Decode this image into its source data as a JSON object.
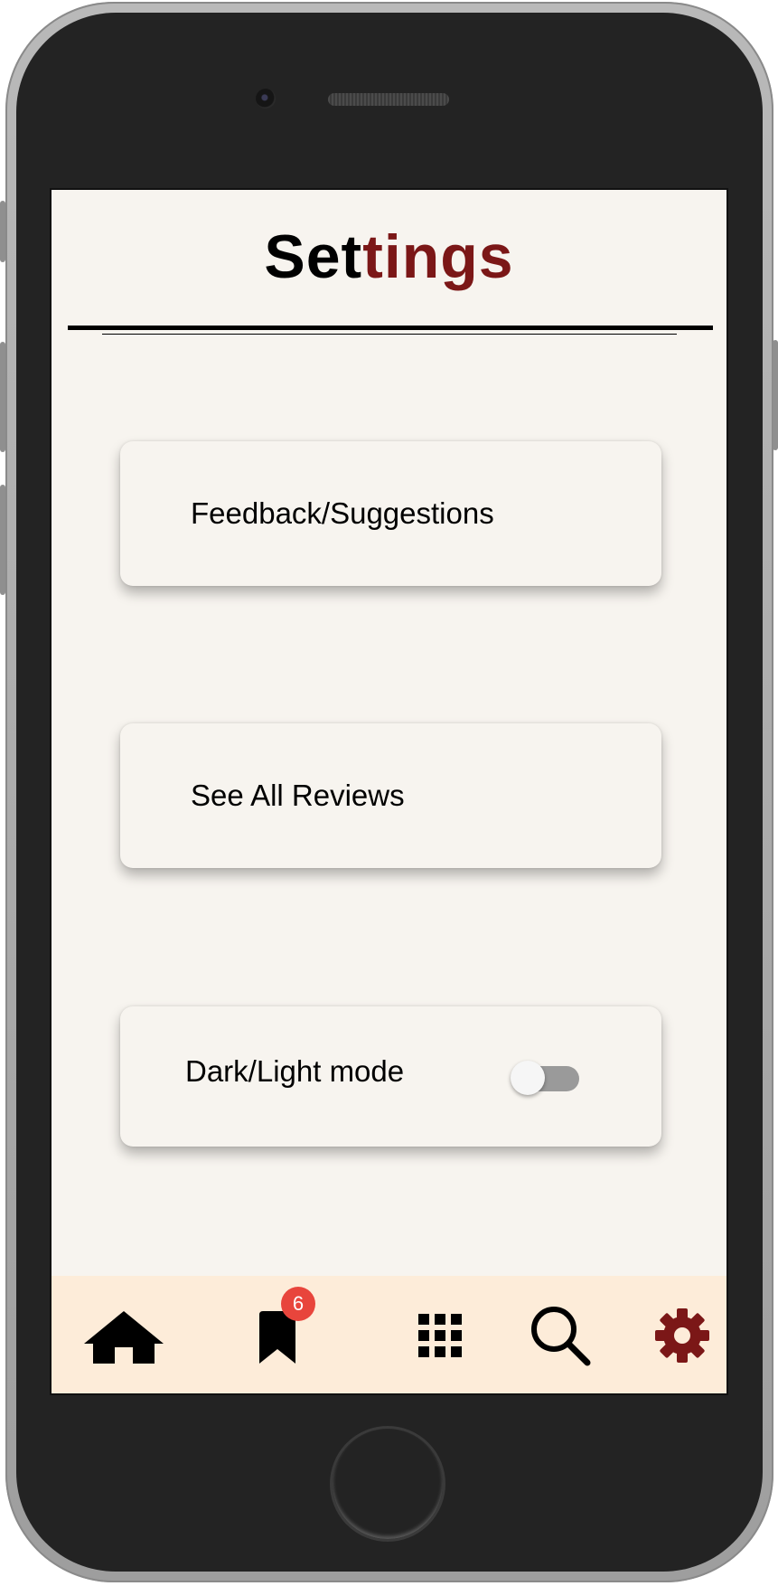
{
  "header": {
    "title_part1": "Set",
    "title_part2": "tings",
    "title_color_primary": "#000000",
    "title_color_accent": "#7b1717"
  },
  "settings": {
    "feedback_label": "Feedback/Suggestions",
    "reviews_label": "See All Reviews",
    "theme_label": "Dark/Light mode",
    "theme_toggle_on": false
  },
  "nav": {
    "items": [
      {
        "name": "home",
        "icon": "home-icon",
        "active": false
      },
      {
        "name": "saved",
        "icon": "bookmark-icon",
        "active": false,
        "badge": "6"
      },
      {
        "name": "categories",
        "icon": "grid-icon",
        "active": false
      },
      {
        "name": "search",
        "icon": "search-icon",
        "active": false
      },
      {
        "name": "settings",
        "icon": "gear-icon",
        "active": true
      }
    ],
    "active_color": "#7b1717",
    "background": "#fdecd9"
  }
}
